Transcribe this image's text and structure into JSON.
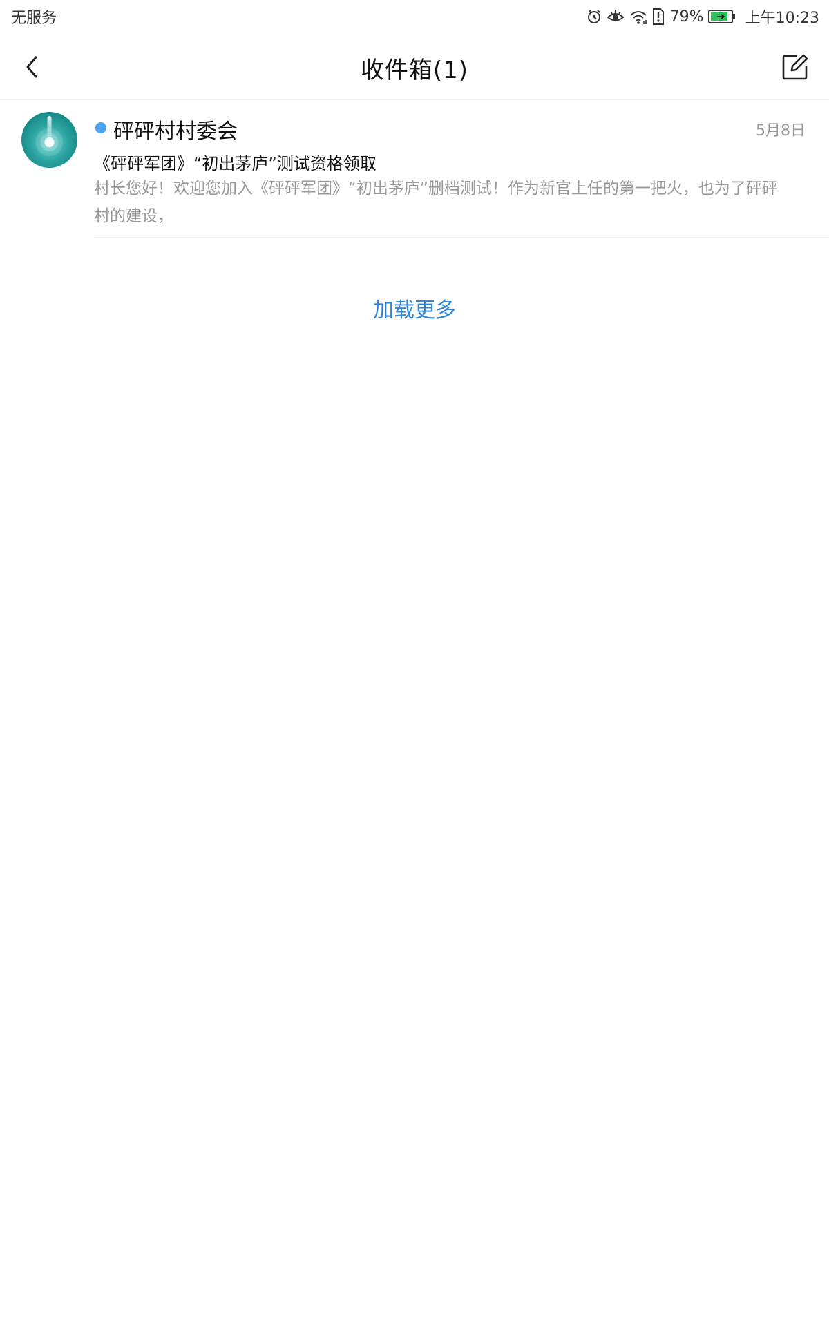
{
  "status_bar": {
    "carrier": "无服务",
    "battery": "79%",
    "time": "上午10:23",
    "icons": [
      "alarm-icon",
      "eye-comfort-icon",
      "wifi-icon",
      "sim-alert-icon",
      "battery-icon"
    ]
  },
  "header": {
    "title": "收件箱(1)",
    "back_icon": "back-arrow-icon",
    "compose_icon": "compose-icon"
  },
  "mail_list": [
    {
      "sender": "砰砰村村委会",
      "date": "5月8日",
      "subject": "《砰砰军团》“初出茅庐”测试资格领取",
      "preview": "村长您好！欢迎您加入《砰砰军团》“初出茅庐”删档测试！作为新官上任的第一把火，也为了砰砰村的建设，",
      "unread": true
    }
  ],
  "load_more": "加载更多",
  "colors": {
    "accent": "#2f86d8",
    "unread_dot": "#4aa3f0",
    "avatar": "#1a918e"
  }
}
